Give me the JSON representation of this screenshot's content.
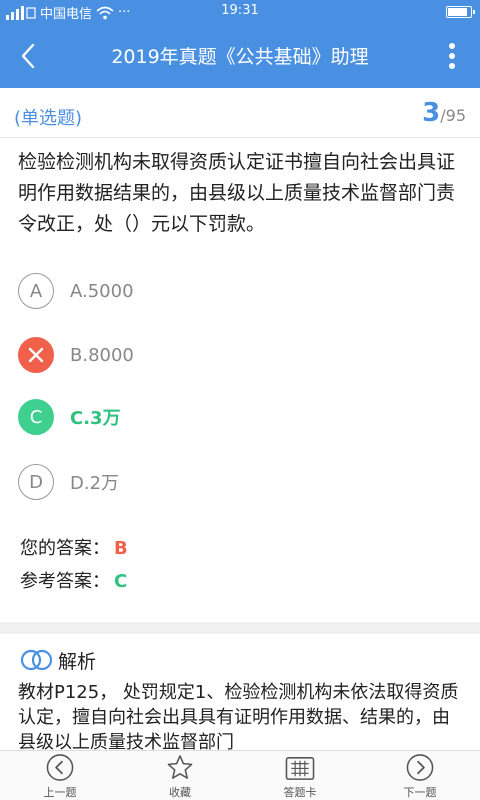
{
  "status": {
    "carrier": "中国电信",
    "dots": "···",
    "time": "19:31",
    "battery_level": 0.9
  },
  "nav": {
    "title": "2019年真题《公共基础》助理"
  },
  "question": {
    "type": "(单选题)",
    "current": "3",
    "total": "/95",
    "text": "检验检测机构未取得资质认定证书擅自向社会出具证明作用数据结果的，由县级以上质量技术监督部门责令改正，处（）元以下罚款。",
    "options": [
      {
        "letter": "A",
        "text": "A.5000",
        "state": "normal"
      },
      {
        "letter": "",
        "text": "B.8000",
        "state": "wrong"
      },
      {
        "letter": "C",
        "text": "C.3万",
        "state": "right"
      },
      {
        "letter": "D",
        "text": "D.2万",
        "state": "normal"
      }
    ]
  },
  "answers": {
    "yours_label": "您的答案：",
    "yours_value": "B",
    "ref_label": "参考答案：",
    "ref_value": "C"
  },
  "analysis": {
    "title": "解析",
    "text": "教材P125， 处罚规定1、检验检测机构未依法取得资质认定，擅自向社会出具具有证明作用数据、结果的，由县级以上质量技术监督部门"
  },
  "bottom": {
    "prev": "上一题",
    "fav": "收藏",
    "card": "答题卡",
    "next": "下一题"
  },
  "colors": {
    "primary": "#4a90e2",
    "wrong": "#f0604a",
    "right": "#3fcf8e"
  }
}
